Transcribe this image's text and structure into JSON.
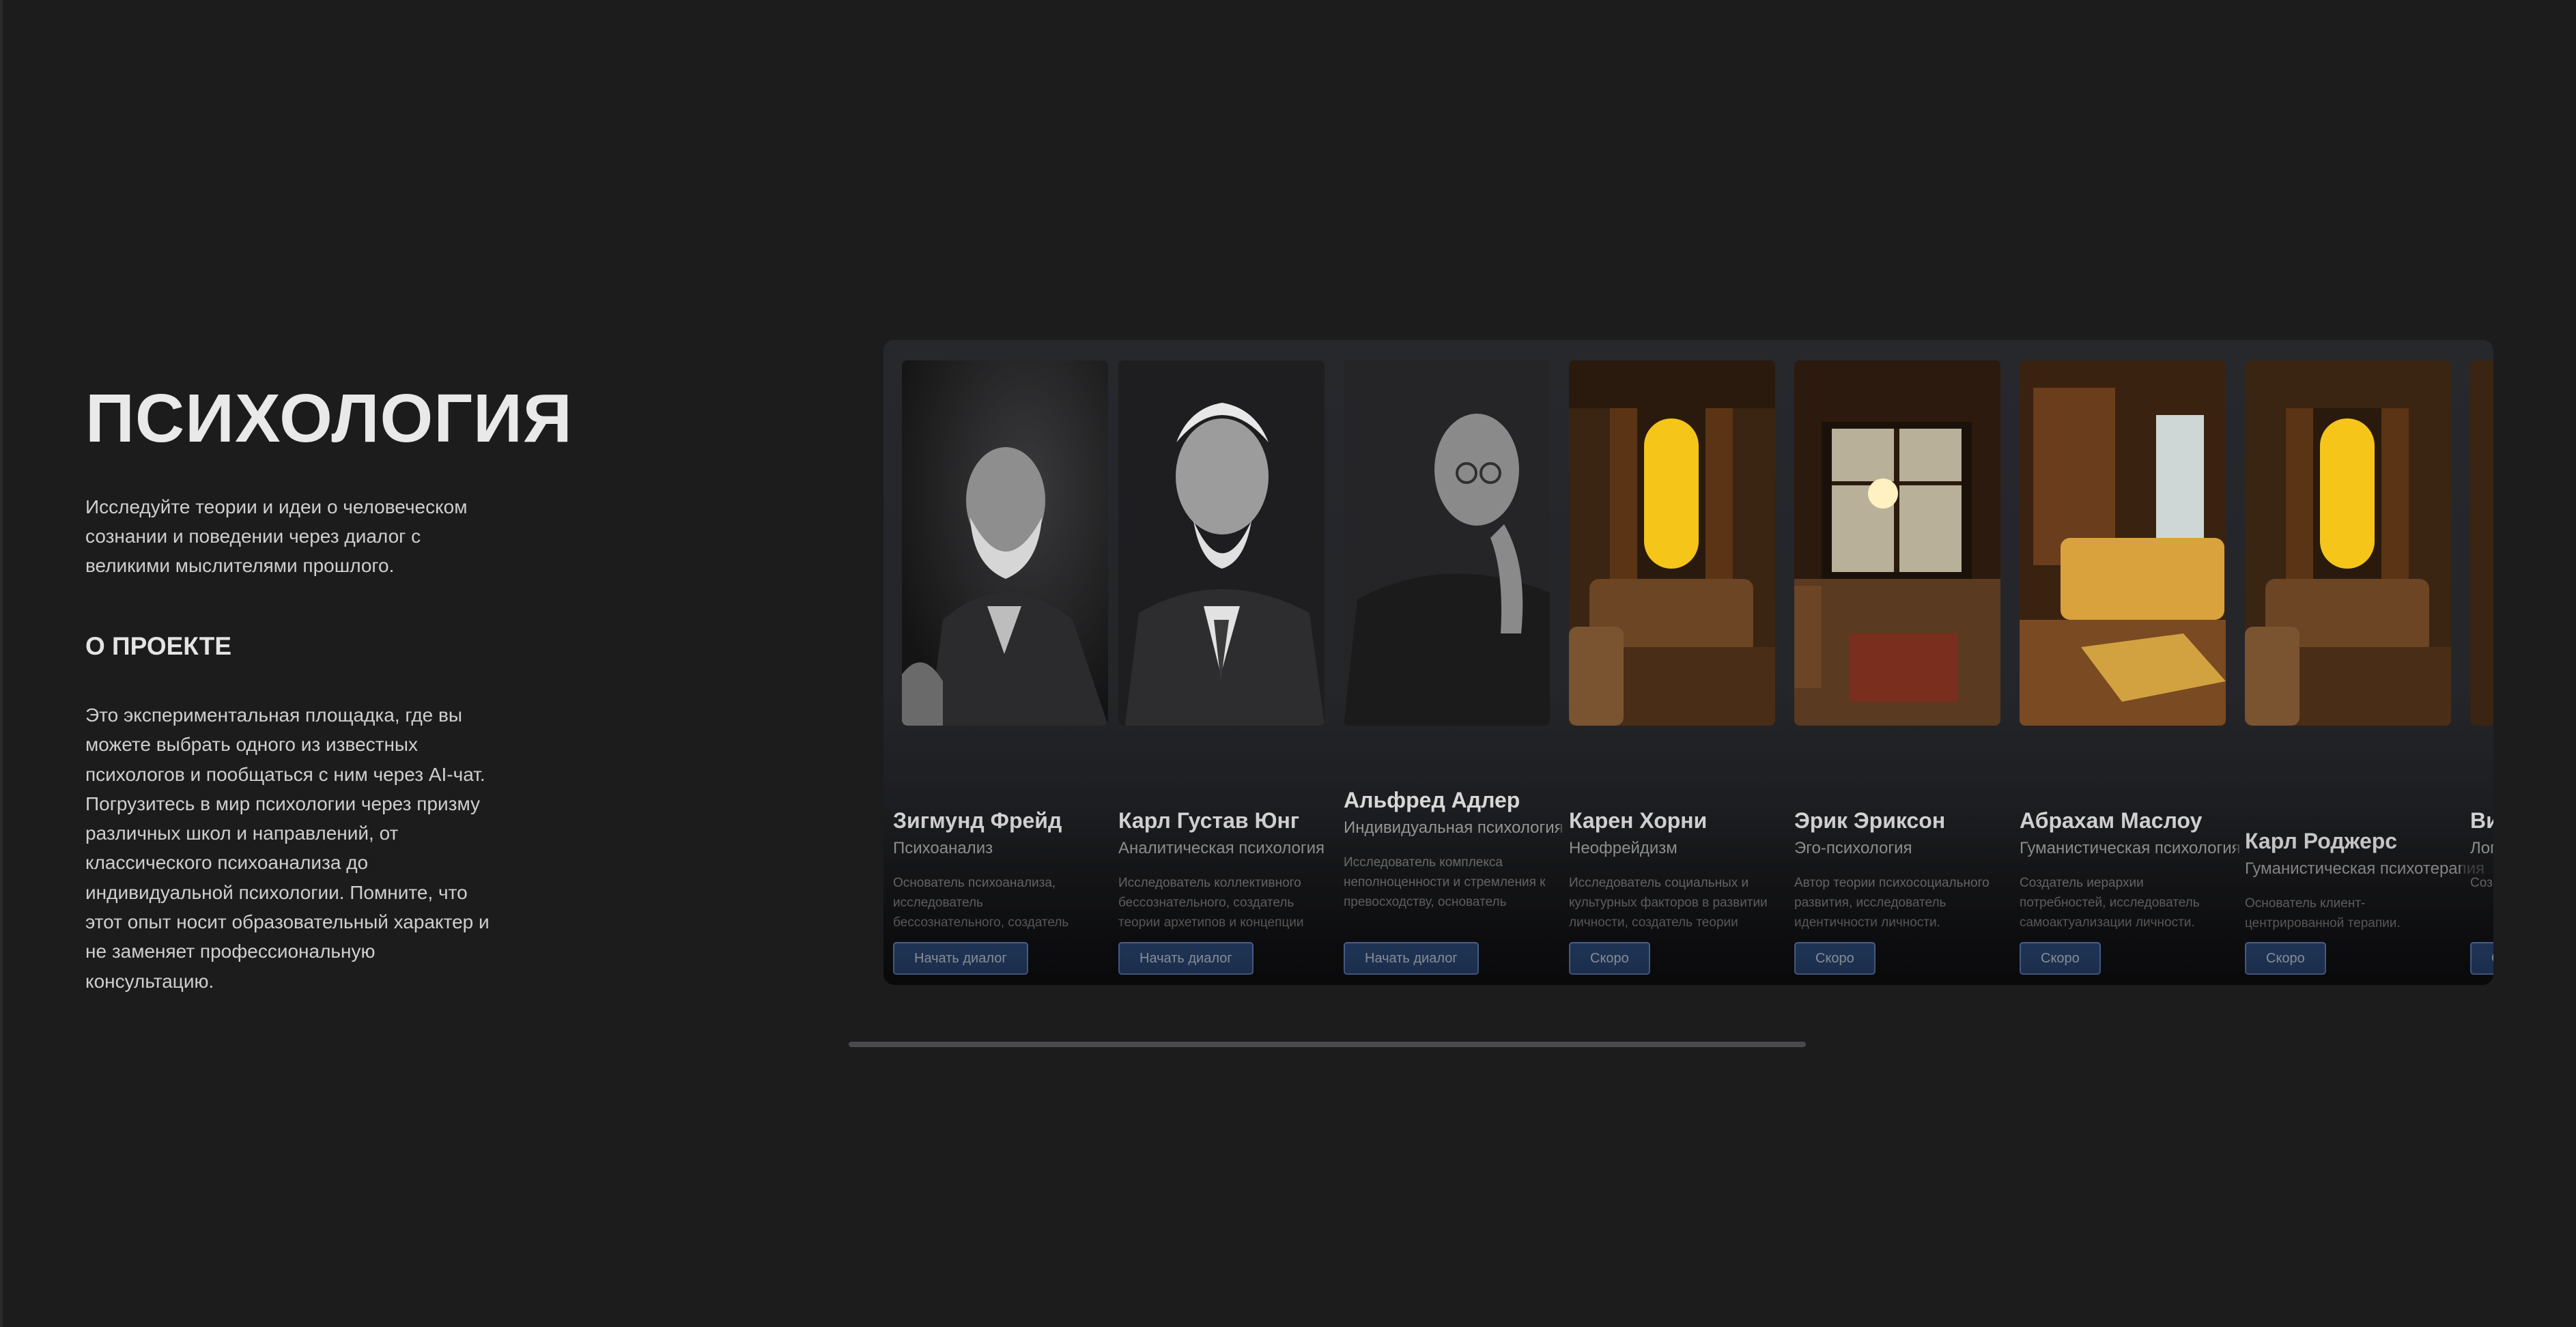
{
  "intro": {
    "title": "ПСИХОЛОГИЯ",
    "subtitle": "Исследуйте теории и идеи о человеческом сознании и поведении через диалог с великими мыслителями прошлого.",
    "about_title": "О ПРОЕКТЕ",
    "about_text": "Это экспериментальная площадка, где вы можете выбрать одного из известных психологов и пообщаться с ним через AI-чат. Погрузитесь в мир психологии через призму различных школ и направлений, от классического психоанализа до индивидуальной психологии. Помните, что этот опыт носит образовательный характер и не заменяет профессиональную консультацию."
  },
  "colors": {
    "background": "#1c1c1d",
    "carousel": "#242528",
    "button": "#2f4f82",
    "button_border": "#6f8fcf",
    "scrollbar": "#4a4a4c"
  },
  "cards": [
    {
      "name": "Зигмунд Фрейд",
      "school": "Психоанализ",
      "description": "Основатель психоанализа, исследователь бессознательного, создатель теории о структуре личности.",
      "button": "Начать диалог",
      "image": "freud-portrait"
    },
    {
      "name": "Карл Густав Юнг",
      "school": "Аналитическая психология",
      "description": "Исследователь коллективного бессознательного, создатель теории архетипов и концепции индивидуации.",
      "button": "Начать диалог",
      "image": "jung-portrait"
    },
    {
      "name": "Альфред Адлер",
      "school": "Индивидуальная психология",
      "description": "Исследователь комплекса неполноценности и стремления к превосходству, основатель индивидуальной психологии.",
      "button": "Начать диалог",
      "image": "adler-portrait"
    },
    {
      "name": "Карен Хорни",
      "school": "Неофрейдизм",
      "description": "Исследователь социальных и культурных факторов в развитии личности, создатель теории базальной тревоги.",
      "button": "Скоро",
      "image": "room-window-placeholder"
    },
    {
      "name": "Эрик Эриксон",
      "school": "Эго-психология",
      "description": "Автор теории психосоциального развития, исследователь идентичности личности.",
      "button": "Скоро",
      "image": "room-sunlit-placeholder"
    },
    {
      "name": "Абрахам Маслоу",
      "school": "Гуманистическая психология",
      "description": "Создатель иерархии потребностей, исследователь самоактуализации личности.",
      "button": "Скоро",
      "image": "room-sofa-placeholder"
    },
    {
      "name": "Карл Роджерс",
      "school": "Гуманистическая психотерапия",
      "description": "Основатель клиент-центрированной терапии.",
      "button": "Скоро",
      "image": "room-window-placeholder"
    },
    {
      "name": "Ви",
      "school": "Лог",
      "description": "Соз смы",
      "button": "С",
      "image": "partial-card"
    }
  ]
}
